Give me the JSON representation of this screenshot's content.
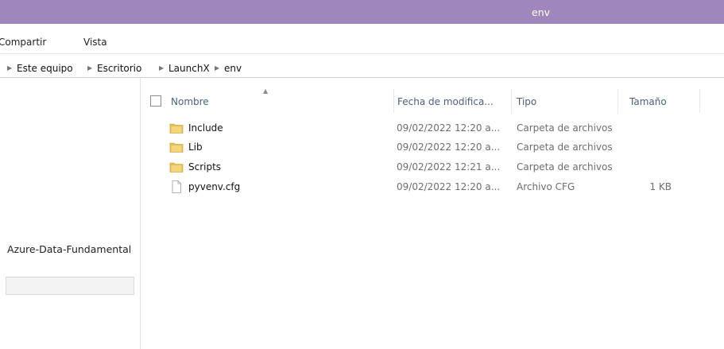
{
  "window": {
    "title": "env"
  },
  "ribbon": {
    "tabs": [
      "Compartir",
      "Vista"
    ]
  },
  "address": {
    "crumbs": [
      "Este equipo",
      "Escritorio",
      "LaunchX",
      "env"
    ]
  },
  "navpane": {
    "item_label": "Azure-Data-Fundamental"
  },
  "columns": {
    "name": "Nombre",
    "date": "Fecha de modifica...",
    "type": "Tipo",
    "size": "Tamaño"
  },
  "files": [
    {
      "name": "Include",
      "date": "09/02/2022 12:20 a...",
      "type": "Carpeta de archivos",
      "size": "",
      "icon": "folder-icon"
    },
    {
      "name": "Lib",
      "date": "09/02/2022 12:20 a...",
      "type": "Carpeta de archivos",
      "size": "",
      "icon": "folder-icon"
    },
    {
      "name": "Scripts",
      "date": "09/02/2022 12:21 a...",
      "type": "Carpeta de archivos",
      "size": "",
      "icon": "folder-icon"
    },
    {
      "name": "pyvenv.cfg",
      "date": "09/02/2022 12:20 a...",
      "type": "Archivo CFG",
      "size": "1 KB",
      "icon": "file-icon"
    }
  ],
  "colors": {
    "titlebar": "#9f86bd",
    "header_text": "#4c607a",
    "folder": "#e8bf52"
  }
}
